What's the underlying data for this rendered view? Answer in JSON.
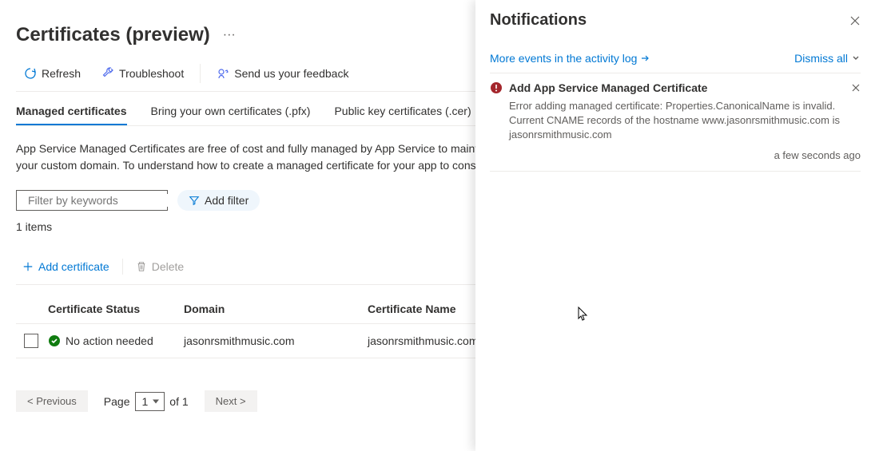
{
  "header": {
    "title": "Certificates (preview)"
  },
  "toolbar": {
    "refresh": "Refresh",
    "troubleshoot": "Troubleshoot",
    "feedback": "Send us your feedback"
  },
  "tabs": {
    "managed": "Managed certificates",
    "bring": "Bring your own certificates (.pfx)",
    "public": "Public key certificates (.cer)"
  },
  "description": "App Service Managed Certificates are free of cost and fully managed by App Service to maintain the security of your apps. You can create a managed certificate against your custom domain. To understand how to create a managed certificate for your app to consume, click on the learn more.",
  "filter": {
    "placeholder": "Filter by keywords",
    "addFilter": "Add filter"
  },
  "itemsCount": "1 items",
  "tableActions": {
    "add": "Add certificate",
    "delete": "Delete"
  },
  "columns": {
    "status": "Certificate Status",
    "domain": "Domain",
    "name": "Certificate Name"
  },
  "rows": [
    {
      "status": "No action needed",
      "domain": "jasonrsmithmusic.com",
      "name": "jasonrsmithmusic.com"
    }
  ],
  "pagination": {
    "previous": "< Previous",
    "pageLabel": "Page",
    "current": "1",
    "of": "of 1",
    "next": "Next >"
  },
  "notifications": {
    "title": "Notifications",
    "moreEvents": "More events in the activity log",
    "dismissAll": "Dismiss all",
    "items": [
      {
        "title": "Add App Service Managed Certificate",
        "body": "Error adding managed certificate: Properties.CanonicalName is invalid.  Current CNAME records of the hostname www.jasonrsmithmusic.com is jasonrsmithmusic.com",
        "time": "a few seconds ago"
      }
    ]
  }
}
